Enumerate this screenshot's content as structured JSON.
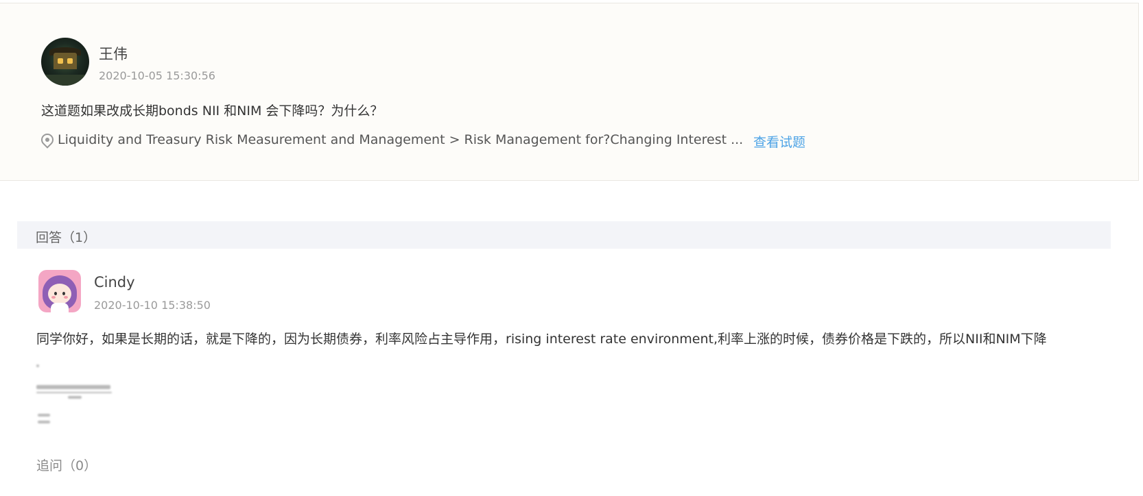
{
  "question": {
    "author": "王伟",
    "timestamp": "2020-10-05 15:30:56",
    "text": "这道题如果改成长期bonds NII 和NIM 会下降吗？为什么？",
    "breadcrumb": "Liquidity and Treasury Risk Measurement and Management > Risk Management for?Changing Interest ...",
    "view_link": "查看试题"
  },
  "answers": {
    "header": "回答（1）",
    "items": [
      {
        "author": "Cindy",
        "timestamp": "2020-10-10 15:38:50",
        "text": "同学你好，如果是长期的话，就是下降的，因为长期债券，利率风险占主导作用，rising interest rate environment,利率上涨的时候，债券价格是下跌的，所以NII和NIM下降"
      }
    ],
    "followup": "追问（0）"
  },
  "colors": {
    "link": "#4da3e6",
    "card_bg": "#fdfcf9",
    "header_bg": "#f3f4f8"
  }
}
